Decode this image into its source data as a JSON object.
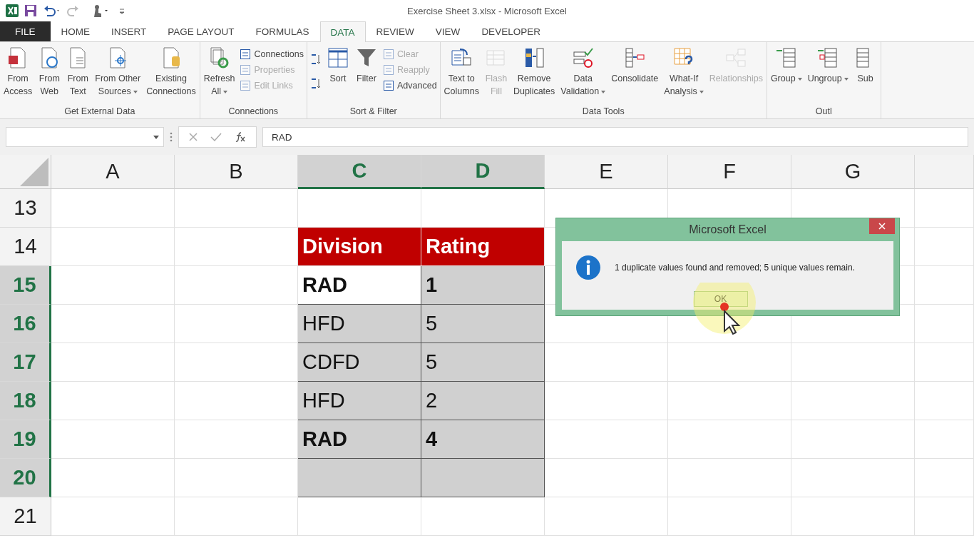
{
  "title_bar": {
    "title": "Exercise Sheet 3.xlsx - Microsoft Excel"
  },
  "ribbon_tabs": [
    {
      "label": "FILE",
      "kind": "file",
      "selected": false
    },
    {
      "label": "HOME",
      "kind": "tab",
      "selected": false
    },
    {
      "label": "INSERT",
      "kind": "tab",
      "selected": false
    },
    {
      "label": "PAGE LAYOUT",
      "kind": "tab",
      "selected": false
    },
    {
      "label": "FORMULAS",
      "kind": "tab",
      "selected": false
    },
    {
      "label": "DATA",
      "kind": "tab",
      "selected": true
    },
    {
      "label": "REVIEW",
      "kind": "tab",
      "selected": false
    },
    {
      "label": "VIEW",
      "kind": "tab",
      "selected": false
    },
    {
      "label": "DEVELOPER",
      "kind": "tab",
      "selected": false
    }
  ],
  "ribbon_groups": [
    {
      "label": "Get External Data",
      "items": [
        {
          "kind": "large",
          "lines": [
            "From",
            "Access"
          ],
          "dropdown": false,
          "disabled": false
        },
        {
          "kind": "large",
          "lines": [
            "From",
            "Web"
          ],
          "dropdown": false,
          "disabled": false
        },
        {
          "kind": "large",
          "lines": [
            "From",
            "Text"
          ],
          "dropdown": false,
          "disabled": false
        },
        {
          "kind": "large",
          "lines": [
            "From Other",
            "Sources"
          ],
          "dropdown": true,
          "disabled": false
        },
        {
          "kind": "large",
          "lines": [
            "Existing",
            "Connections"
          ],
          "dropdown": false,
          "disabled": false
        }
      ]
    },
    {
      "label": "Connections",
      "items": [
        {
          "kind": "large",
          "lines": [
            "Refresh",
            "All"
          ],
          "dropdown": true,
          "disabled": false
        },
        {
          "kind": "stack",
          "items": [
            {
              "label": "Connections",
              "disabled": false
            },
            {
              "label": "Properties",
              "disabled": true
            },
            {
              "label": "Edit Links",
              "disabled": true
            }
          ]
        }
      ]
    },
    {
      "label": "Sort & Filter",
      "items": [
        {
          "kind": "sort-icons"
        },
        {
          "kind": "large",
          "lines": [
            "Sort"
          ],
          "dropdown": false,
          "disabled": false
        },
        {
          "kind": "large",
          "lines": [
            "Filter"
          ],
          "dropdown": false,
          "disabled": false
        },
        {
          "kind": "stack",
          "items": [
            {
              "label": "Clear",
              "disabled": true
            },
            {
              "label": "Reapply",
              "disabled": true
            },
            {
              "label": "Advanced",
              "disabled": false
            }
          ]
        }
      ]
    },
    {
      "label": "Data Tools",
      "items": [
        {
          "kind": "large",
          "lines": [
            "Text to",
            "Columns"
          ],
          "dropdown": false,
          "disabled": false
        },
        {
          "kind": "large",
          "lines": [
            "Flash",
            "Fill"
          ],
          "dropdown": false,
          "disabled": true
        },
        {
          "kind": "large",
          "lines": [
            "Remove",
            "Duplicates"
          ],
          "dropdown": false,
          "disabled": false
        },
        {
          "kind": "large",
          "lines": [
            "Data",
            "Validation"
          ],
          "dropdown": true,
          "disabled": false
        },
        {
          "kind": "large",
          "lines": [
            "Consolidate"
          ],
          "dropdown": false,
          "disabled": false
        },
        {
          "kind": "large",
          "lines": [
            "What-If",
            "Analysis"
          ],
          "dropdown": true,
          "disabled": false
        },
        {
          "kind": "large",
          "lines": [
            "Relationships"
          ],
          "dropdown": false,
          "disabled": true
        }
      ]
    },
    {
      "label": "Outl",
      "items": [
        {
          "kind": "large",
          "lines": [
            "Group"
          ],
          "dropdown": true,
          "disabled": false
        },
        {
          "kind": "large",
          "lines": [
            "Ungroup"
          ],
          "dropdown": true,
          "disabled": false
        },
        {
          "kind": "large",
          "lines": [
            "Sub"
          ],
          "dropdown": false,
          "disabled": false
        }
      ]
    }
  ],
  "formula_bar": {
    "value": "RAD"
  },
  "columns": [
    {
      "label": "A",
      "selected": false
    },
    {
      "label": "B",
      "selected": false
    },
    {
      "label": "C",
      "selected": true
    },
    {
      "label": "D",
      "selected": true
    },
    {
      "label": "E",
      "selected": false
    },
    {
      "label": "F",
      "selected": false
    },
    {
      "label": "G",
      "selected": false
    }
  ],
  "rows": [
    {
      "number": "13",
      "selected": false
    },
    {
      "number": "14",
      "selected": false
    },
    {
      "number": "15",
      "selected": true
    },
    {
      "number": "16",
      "selected": true
    },
    {
      "number": "17",
      "selected": true
    },
    {
      "number": "18",
      "selected": true
    },
    {
      "number": "19",
      "selected": true
    },
    {
      "number": "20",
      "selected": true
    },
    {
      "number": "21",
      "selected": false
    }
  ],
  "table": {
    "headers": [
      "Division",
      "Rating"
    ],
    "rows": [
      {
        "bold": true,
        "cells": [
          {
            "text": "RAD",
            "active": true
          },
          {
            "text": "1",
            "active": false
          }
        ]
      },
      {
        "bold": false,
        "cells": [
          {
            "text": "HFD",
            "active": false
          },
          {
            "text": "5",
            "active": false
          }
        ]
      },
      {
        "bold": false,
        "cells": [
          {
            "text": "CDFD",
            "active": false
          },
          {
            "text": "5",
            "active": false
          }
        ]
      },
      {
        "bold": false,
        "cells": [
          {
            "text": "HFD",
            "active": false
          },
          {
            "text": "2",
            "active": false
          }
        ]
      },
      {
        "bold": true,
        "cells": [
          {
            "text": "RAD",
            "active": false
          },
          {
            "text": "4",
            "active": false
          }
        ]
      }
    ]
  },
  "dialog": {
    "title": "Microsoft Excel",
    "message": "1 duplicate values found and removed; 5 unique values remain.",
    "button": "OK"
  }
}
